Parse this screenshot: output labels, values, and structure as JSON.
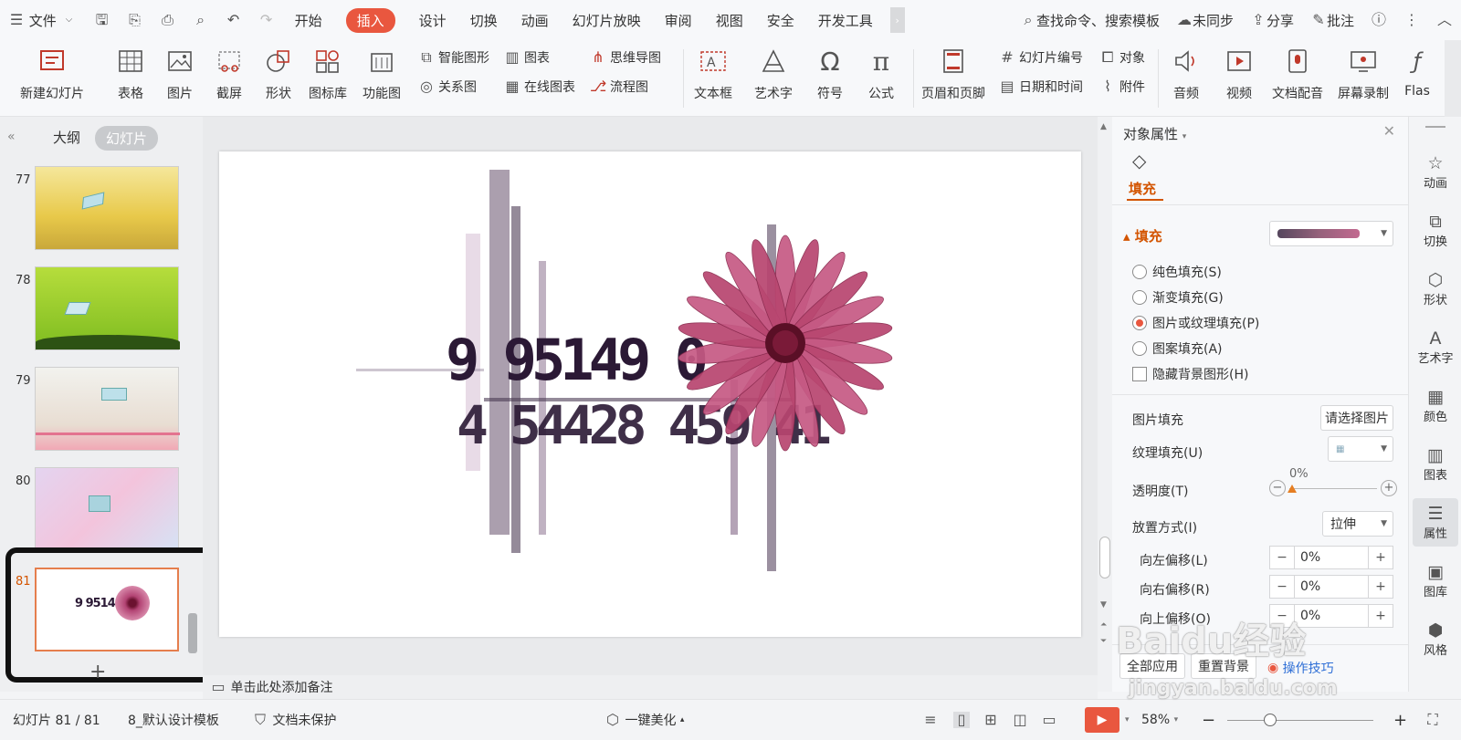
{
  "menubar": {
    "file_label": "文件",
    "tabs": [
      "开始",
      "插入",
      "设计",
      "切换",
      "动画",
      "幻灯片放映",
      "审阅",
      "视图",
      "安全",
      "开发工具"
    ],
    "active_tab": "插入",
    "search_placeholder": "查找命令、搜索模板",
    "sync_label": "未同步",
    "share_label": "分享",
    "comment_label": "批注"
  },
  "ribbon": {
    "new_slide": "新建幻灯片",
    "table": "表格",
    "picture": "图片",
    "screenshot": "截屏",
    "shape": "形状",
    "icon_lib": "图标库",
    "func_chart": "功能图",
    "smart_art": "智能图形",
    "chart": "图表",
    "mind_map": "思维导图",
    "relation": "关系图",
    "online_chart": "在线图表",
    "flowchart": "流程图",
    "textbox": "文本框",
    "wordart": "艺术字",
    "symbol": "符号",
    "formula": "公式",
    "header_footer": "页眉和页脚",
    "slide_number": "幻灯片编号",
    "object": "对象",
    "date_time": "日期和时间",
    "attachment": "附件",
    "audio": "音频",
    "video": "视频",
    "voiceover": "文档配音",
    "screen_record": "屏幕录制",
    "flash": "Flas"
  },
  "left_panel": {
    "tab_outline": "大纲",
    "tab_slides": "幻灯片",
    "slides": [
      "77",
      "78",
      "79",
      "80",
      "81"
    ],
    "selected": "81"
  },
  "slide_art": {
    "numbers_line1": "9 95149 0",
    "numbers_line2": "4 54428 459 41"
  },
  "notes": {
    "placeholder": "单击此处添加备注"
  },
  "properties": {
    "title": "对象属性",
    "tab_fill": "填充",
    "section_fill": "填充",
    "options": [
      "纯色填充(S)",
      "渐变填充(G)",
      "图片或纹理填充(P)",
      "图案填充(A)"
    ],
    "selected_option": "图片或纹理填充(P)",
    "hide_bg": "隐藏背景图形(H)",
    "picture_fill_label": "图片填充",
    "picture_fill_value": "请选择图片",
    "texture_fill_label": "纹理填充(U)",
    "transparency_label": "透明度(T)",
    "transparency_value": "0%",
    "placement_label": "放置方式(I)",
    "placement_value": "拉伸",
    "offset_left_label": "向左偏移(L)",
    "offset_left_value": "0%",
    "offset_right_label": "向右偏移(R)",
    "offset_right_value": "0%",
    "offset_up_label": "向上偏移(O)",
    "offset_up_value": "0%",
    "apply_all": "全部应用",
    "reset_bg": "重置背景",
    "tips": "操作技巧"
  },
  "right_bar": [
    "动画",
    "切换",
    "形状",
    "艺术字",
    "颜色",
    "图表",
    "属性",
    "图库",
    "风格"
  ],
  "status": {
    "slide_info": "幻灯片 81 / 81",
    "template": "8_默认设计模板",
    "protect": "文档未保护",
    "beautify": "一键美化",
    "zoom": "58%"
  },
  "watermark": {
    "brand": "Baidu经验",
    "url": "jingyan.baidu.com"
  },
  "colors": {
    "accent": "#e9573f",
    "flower": "#a8325e"
  }
}
